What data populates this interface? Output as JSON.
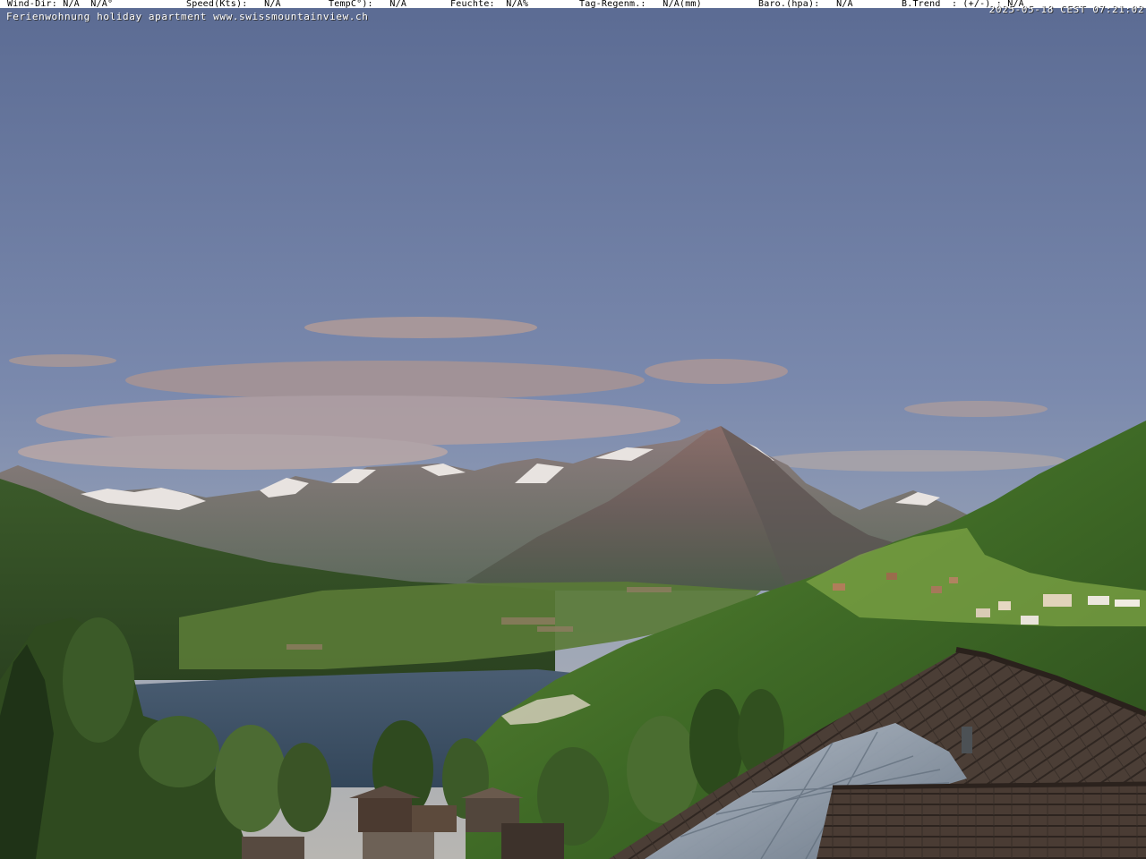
{
  "weather_bar": {
    "wind_dir": "Wind-Dir: N/A  N/A°",
    "speed": "Speed(Kts):   N/A",
    "temp": "TempC°):   N/A",
    "feuchte": "Feuchte:  N/A%",
    "regen": "Tag-Regenm.:   N/A(mm)",
    "baro": "Baro.(hpa):   N/A",
    "trend": "B.Trend  : (+/-) : N/A"
  },
  "caption": "Ferienwohnung holiday apartment www.swissmountainview.ch",
  "timestamp": "2025-05-18 CEST 07:21:02",
  "scene": {
    "description_tags": [
      "sky",
      "clouds",
      "alpine-peak",
      "snow-ridges",
      "lake",
      "forest-slope",
      "village",
      "roof",
      "solar-panels",
      "trees"
    ],
    "colors": {
      "sky_top": "#5e6f97",
      "sky_horizon": "#b2b6b8",
      "cloud": "#a8969a",
      "mountain": "#6a6264",
      "lake": "#3a4d63",
      "forest": "#3c5a25",
      "roof": "#4a3d36",
      "solar": "#9aa7b6"
    }
  }
}
